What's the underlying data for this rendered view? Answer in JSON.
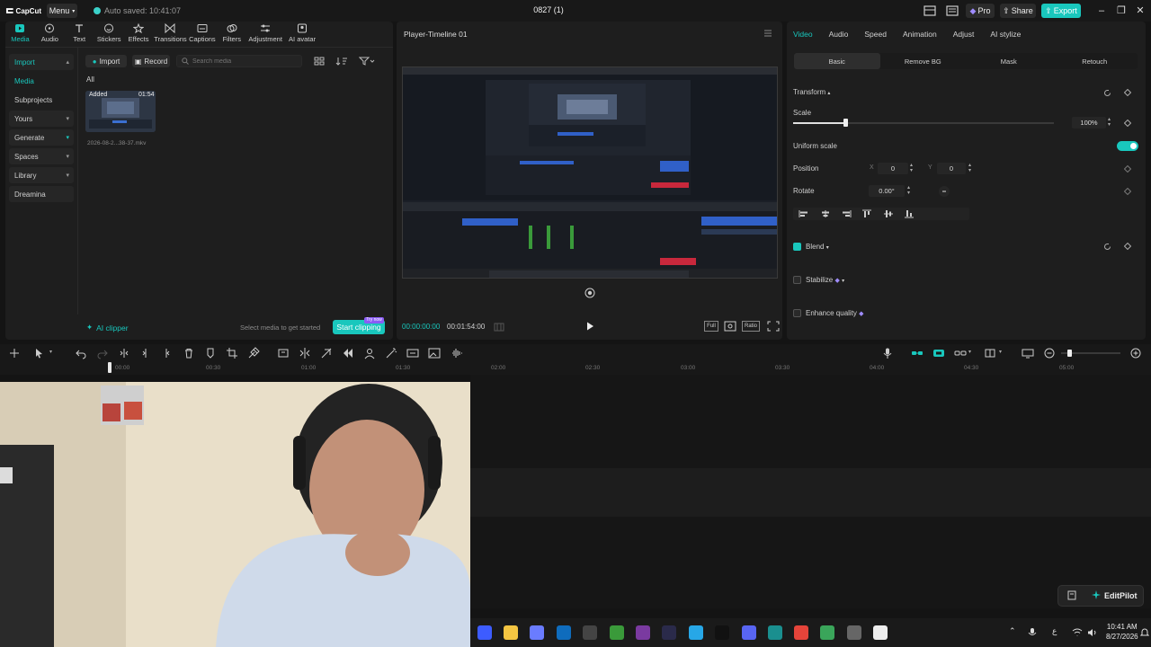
{
  "app": {
    "logo": "CapCut",
    "menu_label": "Menu",
    "autosave": "Auto saved: 10:41:07",
    "project_title": "0827 (1)",
    "pro_label": "Pro",
    "share_label": "Share",
    "export_label": "Export"
  },
  "toolbar": {
    "tabs": [
      {
        "label": "Media",
        "icon": "media-icon"
      },
      {
        "label": "Audio",
        "icon": "audio-icon"
      },
      {
        "label": "Text",
        "icon": "text-icon"
      },
      {
        "label": "Stickers",
        "icon": "stickers-icon"
      },
      {
        "label": "Effects",
        "icon": "effects-icon"
      },
      {
        "label": "Transitions",
        "icon": "transitions-icon"
      },
      {
        "label": "Captions",
        "icon": "captions-icon"
      },
      {
        "label": "Filters",
        "icon": "filters-icon"
      },
      {
        "label": "Adjustment",
        "icon": "adjustment-icon"
      },
      {
        "label": "AI avatar",
        "icon": "ai-avatar-icon"
      }
    ]
  },
  "sidebar": {
    "items": [
      {
        "label": "Import"
      },
      {
        "label": "Media"
      },
      {
        "label": "Subprojects"
      },
      {
        "label": "Yours"
      },
      {
        "label": "Generate"
      },
      {
        "label": "Spaces"
      },
      {
        "label": "Library"
      },
      {
        "label": "Dreamina"
      }
    ]
  },
  "media": {
    "import_label": "Import",
    "record_label": "Record",
    "search_placeholder": "Search media",
    "filter_all": "All",
    "clip": {
      "added_label": "Added",
      "duration": "01:54",
      "filename": "2026-08-2...38-37.mkv"
    },
    "ai_clipper": "AI clipper",
    "select_hint": "Select media to get started",
    "start_clipping": "Start clipping",
    "try_badge": "Try now"
  },
  "player": {
    "title": "Player-Timeline 01",
    "current_time": "00:00:00:00",
    "total_time": "00:01:54:00",
    "full_label": "Full",
    "ratio_label": "Ratio"
  },
  "properties": {
    "tabs": [
      "Video",
      "Audio",
      "Speed",
      "Animation",
      "Adjust",
      "AI stylize"
    ],
    "sub_tabs": [
      "Basic",
      "Remove BG",
      "Mask",
      "Retouch"
    ],
    "transform_label": "Transform",
    "scale_label": "Scale",
    "scale_value": "100%",
    "scale_fraction": 0.2,
    "uniform_scale_label": "Uniform scale",
    "uniform_scale_on": true,
    "position_label": "Position",
    "position_x_label": "X",
    "position_x": "0",
    "position_y_label": "Y",
    "position_y": "0",
    "rotate_label": "Rotate",
    "rotate_value": "0.00°",
    "blend_label": "Blend",
    "stabilize_label": "Stabilize",
    "enhance_label": "Enhance quality"
  },
  "timeline": {
    "ticks": [
      "00:00",
      "00:30",
      "01:00",
      "01:30",
      "02:00",
      "02:30",
      "03:00",
      "03:30",
      "04:00",
      "04:30",
      "05:00"
    ]
  },
  "editpilot": {
    "label": "EditPilot"
  },
  "taskbar": {
    "time": "10:41 AM",
    "date": "8/27/2026",
    "lang": "ع"
  },
  "colors": {
    "accent": "#19c7bd",
    "badge": "#8b5cf6"
  }
}
